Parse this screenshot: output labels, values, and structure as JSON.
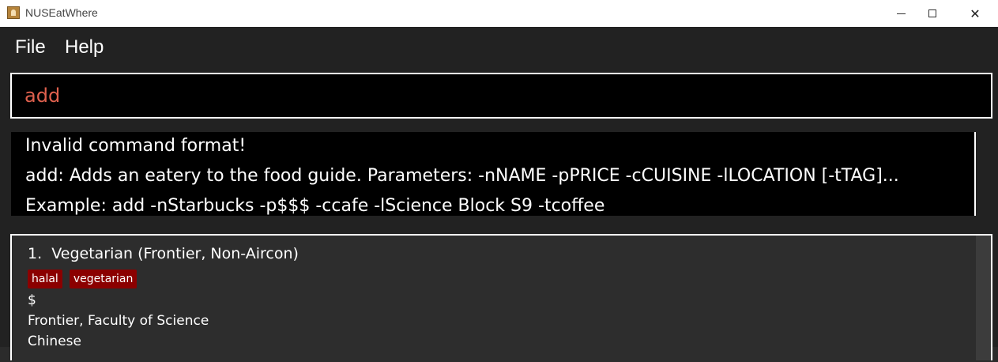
{
  "window": {
    "title": "NUSEatWhere",
    "close_glyph": "✕"
  },
  "menu": {
    "items": [
      {
        "label": "File"
      },
      {
        "label": "Help"
      }
    ]
  },
  "command_box": {
    "value": "add"
  },
  "result_display": {
    "lines": [
      "Invalid command format!",
      "add: Adds an eatery to the food guide. Parameters: -nNAME -pPRICE -cCUISINE -lLOCATION [-tTAG]...",
      "Example: add -nStarbucks -p$$$ -ccafe -lScience Block S9 -tcoffee"
    ]
  },
  "eatery_list": {
    "items": [
      {
        "index": "1.",
        "name": "Vegetarian (Frontier, Non-Aircon)",
        "tags": [
          "halal",
          "vegetarian"
        ],
        "price": "$",
        "location": "Frontier, Faculty of Science",
        "cuisine": "Chinese"
      }
    ]
  },
  "colors": {
    "background": "#222222",
    "command_text": "#e0614e",
    "tag_background": "#8b0000"
  }
}
